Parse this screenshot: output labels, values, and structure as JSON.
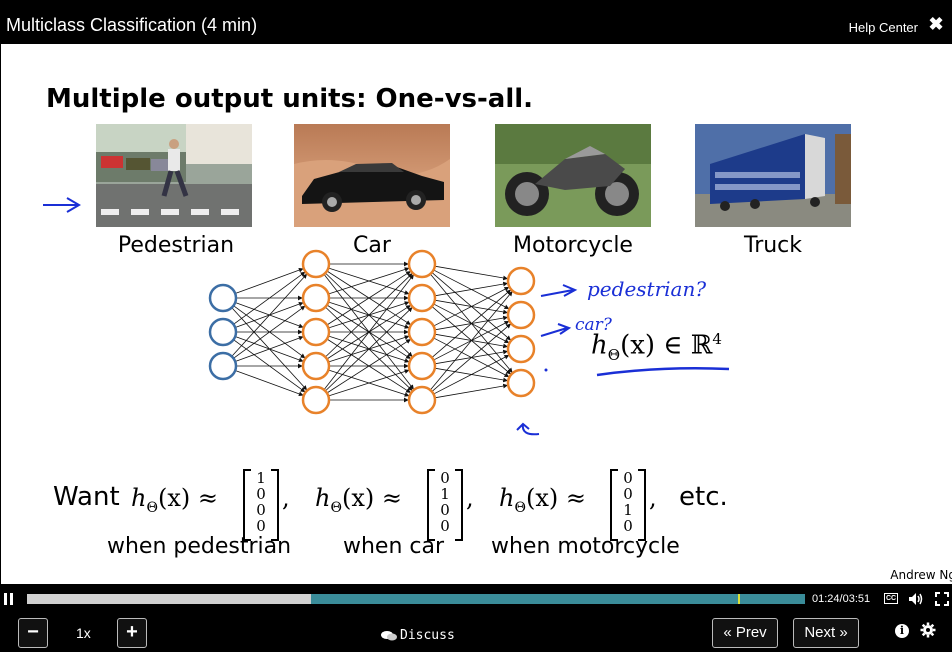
{
  "header": {
    "title": "Multiclass Classification (4 min)",
    "help_label": "Help Center",
    "close_icon": "close-icon"
  },
  "slide": {
    "title": "Multiple output units: One-vs-all.",
    "categories": [
      {
        "label": "Pedestrian",
        "image_icon": "pedestrian-photo"
      },
      {
        "label": "Car",
        "image_icon": "car-photo"
      },
      {
        "label": "Motorcycle",
        "image_icon": "motorcycle-photo"
      },
      {
        "label": "Truck",
        "image_icon": "truck-photo"
      }
    ],
    "network": {
      "layer_sizes": [
        3,
        5,
        5,
        4
      ],
      "input_color": "#3c6ea5",
      "hidden_color": "#e8822a",
      "ink_color": "#1a2fd6"
    },
    "annotations": {
      "pedestrian": "pedestrian?",
      "car": "car?"
    },
    "output_formula": {
      "h": "h",
      "sub": "Θ",
      "arg": "(x) ∈ ℝ",
      "sup": "4"
    },
    "want": {
      "word": "Want",
      "expr": "h",
      "sub": "Θ",
      "rest": "(x) ≈",
      "vectors": [
        [
          "1",
          "0",
          "0",
          "0"
        ],
        [
          "0",
          "1",
          "0",
          "0"
        ],
        [
          "0",
          "0",
          "1",
          "0"
        ]
      ],
      "comma": ",",
      "etc": "etc."
    },
    "when_labels": [
      "when pedestrian",
      "when car",
      "when motorcycle"
    ],
    "author": "Andrew Ng"
  },
  "player": {
    "progress": 0.365,
    "marker": 0.914,
    "current_time": "01:24",
    "separator": "/",
    "duration": "03:51",
    "cc_label": "CC",
    "speed": "1x",
    "minus_label": "−",
    "plus_label": "+",
    "discuss_label": "Discuss",
    "prev_label": "« Prev",
    "next_label": "Next »",
    "info_label": "i"
  }
}
